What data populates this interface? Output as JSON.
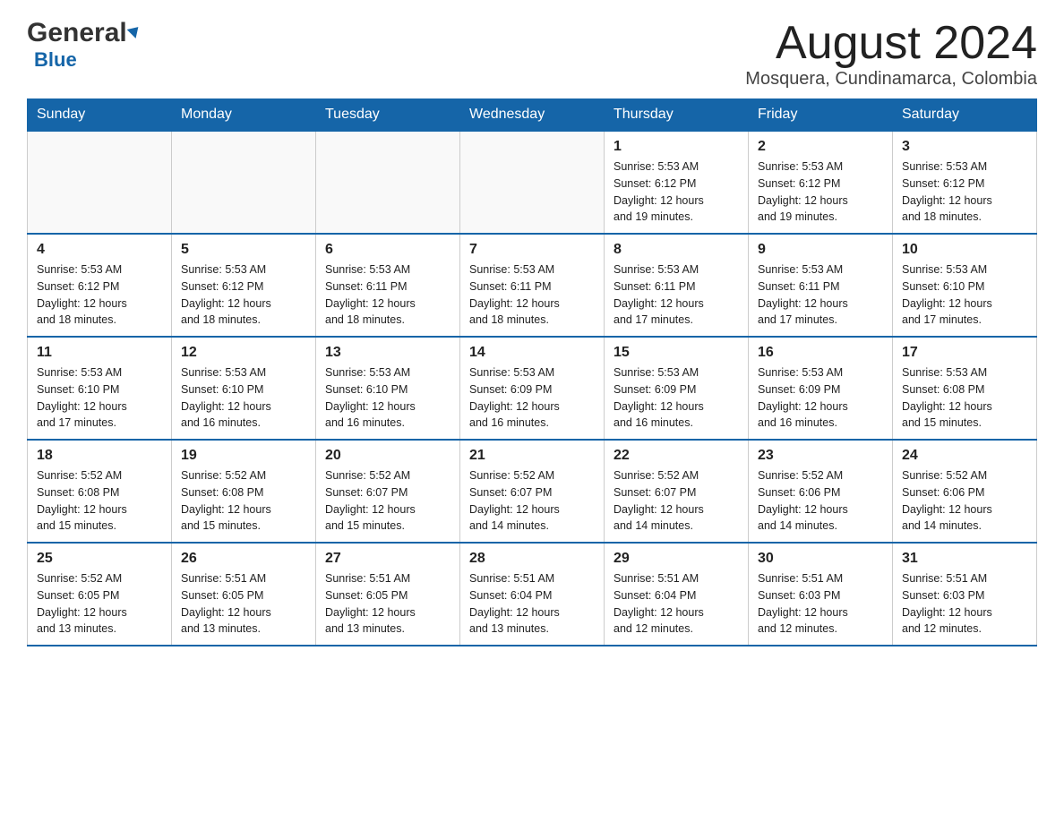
{
  "header": {
    "logo_general": "General",
    "logo_blue": "Blue",
    "month_title": "August 2024",
    "subtitle": "Mosquera, Cundinamarca, Colombia"
  },
  "days_of_week": [
    "Sunday",
    "Monday",
    "Tuesday",
    "Wednesday",
    "Thursday",
    "Friday",
    "Saturday"
  ],
  "weeks": [
    {
      "days": [
        {
          "number": "",
          "info": ""
        },
        {
          "number": "",
          "info": ""
        },
        {
          "number": "",
          "info": ""
        },
        {
          "number": "",
          "info": ""
        },
        {
          "number": "1",
          "info": "Sunrise: 5:53 AM\nSunset: 6:12 PM\nDaylight: 12 hours\nand 19 minutes."
        },
        {
          "number": "2",
          "info": "Sunrise: 5:53 AM\nSunset: 6:12 PM\nDaylight: 12 hours\nand 19 minutes."
        },
        {
          "number": "3",
          "info": "Sunrise: 5:53 AM\nSunset: 6:12 PM\nDaylight: 12 hours\nand 18 minutes."
        }
      ]
    },
    {
      "days": [
        {
          "number": "4",
          "info": "Sunrise: 5:53 AM\nSunset: 6:12 PM\nDaylight: 12 hours\nand 18 minutes."
        },
        {
          "number": "5",
          "info": "Sunrise: 5:53 AM\nSunset: 6:12 PM\nDaylight: 12 hours\nand 18 minutes."
        },
        {
          "number": "6",
          "info": "Sunrise: 5:53 AM\nSunset: 6:11 PM\nDaylight: 12 hours\nand 18 minutes."
        },
        {
          "number": "7",
          "info": "Sunrise: 5:53 AM\nSunset: 6:11 PM\nDaylight: 12 hours\nand 18 minutes."
        },
        {
          "number": "8",
          "info": "Sunrise: 5:53 AM\nSunset: 6:11 PM\nDaylight: 12 hours\nand 17 minutes."
        },
        {
          "number": "9",
          "info": "Sunrise: 5:53 AM\nSunset: 6:11 PM\nDaylight: 12 hours\nand 17 minutes."
        },
        {
          "number": "10",
          "info": "Sunrise: 5:53 AM\nSunset: 6:10 PM\nDaylight: 12 hours\nand 17 minutes."
        }
      ]
    },
    {
      "days": [
        {
          "number": "11",
          "info": "Sunrise: 5:53 AM\nSunset: 6:10 PM\nDaylight: 12 hours\nand 17 minutes."
        },
        {
          "number": "12",
          "info": "Sunrise: 5:53 AM\nSunset: 6:10 PM\nDaylight: 12 hours\nand 16 minutes."
        },
        {
          "number": "13",
          "info": "Sunrise: 5:53 AM\nSunset: 6:10 PM\nDaylight: 12 hours\nand 16 minutes."
        },
        {
          "number": "14",
          "info": "Sunrise: 5:53 AM\nSunset: 6:09 PM\nDaylight: 12 hours\nand 16 minutes."
        },
        {
          "number": "15",
          "info": "Sunrise: 5:53 AM\nSunset: 6:09 PM\nDaylight: 12 hours\nand 16 minutes."
        },
        {
          "number": "16",
          "info": "Sunrise: 5:53 AM\nSunset: 6:09 PM\nDaylight: 12 hours\nand 16 minutes."
        },
        {
          "number": "17",
          "info": "Sunrise: 5:53 AM\nSunset: 6:08 PM\nDaylight: 12 hours\nand 15 minutes."
        }
      ]
    },
    {
      "days": [
        {
          "number": "18",
          "info": "Sunrise: 5:52 AM\nSunset: 6:08 PM\nDaylight: 12 hours\nand 15 minutes."
        },
        {
          "number": "19",
          "info": "Sunrise: 5:52 AM\nSunset: 6:08 PM\nDaylight: 12 hours\nand 15 minutes."
        },
        {
          "number": "20",
          "info": "Sunrise: 5:52 AM\nSunset: 6:07 PM\nDaylight: 12 hours\nand 15 minutes."
        },
        {
          "number": "21",
          "info": "Sunrise: 5:52 AM\nSunset: 6:07 PM\nDaylight: 12 hours\nand 14 minutes."
        },
        {
          "number": "22",
          "info": "Sunrise: 5:52 AM\nSunset: 6:07 PM\nDaylight: 12 hours\nand 14 minutes."
        },
        {
          "number": "23",
          "info": "Sunrise: 5:52 AM\nSunset: 6:06 PM\nDaylight: 12 hours\nand 14 minutes."
        },
        {
          "number": "24",
          "info": "Sunrise: 5:52 AM\nSunset: 6:06 PM\nDaylight: 12 hours\nand 14 minutes."
        }
      ]
    },
    {
      "days": [
        {
          "number": "25",
          "info": "Sunrise: 5:52 AM\nSunset: 6:05 PM\nDaylight: 12 hours\nand 13 minutes."
        },
        {
          "number": "26",
          "info": "Sunrise: 5:51 AM\nSunset: 6:05 PM\nDaylight: 12 hours\nand 13 minutes."
        },
        {
          "number": "27",
          "info": "Sunrise: 5:51 AM\nSunset: 6:05 PM\nDaylight: 12 hours\nand 13 minutes."
        },
        {
          "number": "28",
          "info": "Sunrise: 5:51 AM\nSunset: 6:04 PM\nDaylight: 12 hours\nand 13 minutes."
        },
        {
          "number": "29",
          "info": "Sunrise: 5:51 AM\nSunset: 6:04 PM\nDaylight: 12 hours\nand 12 minutes."
        },
        {
          "number": "30",
          "info": "Sunrise: 5:51 AM\nSunset: 6:03 PM\nDaylight: 12 hours\nand 12 minutes."
        },
        {
          "number": "31",
          "info": "Sunrise: 5:51 AM\nSunset: 6:03 PM\nDaylight: 12 hours\nand 12 minutes."
        }
      ]
    }
  ]
}
